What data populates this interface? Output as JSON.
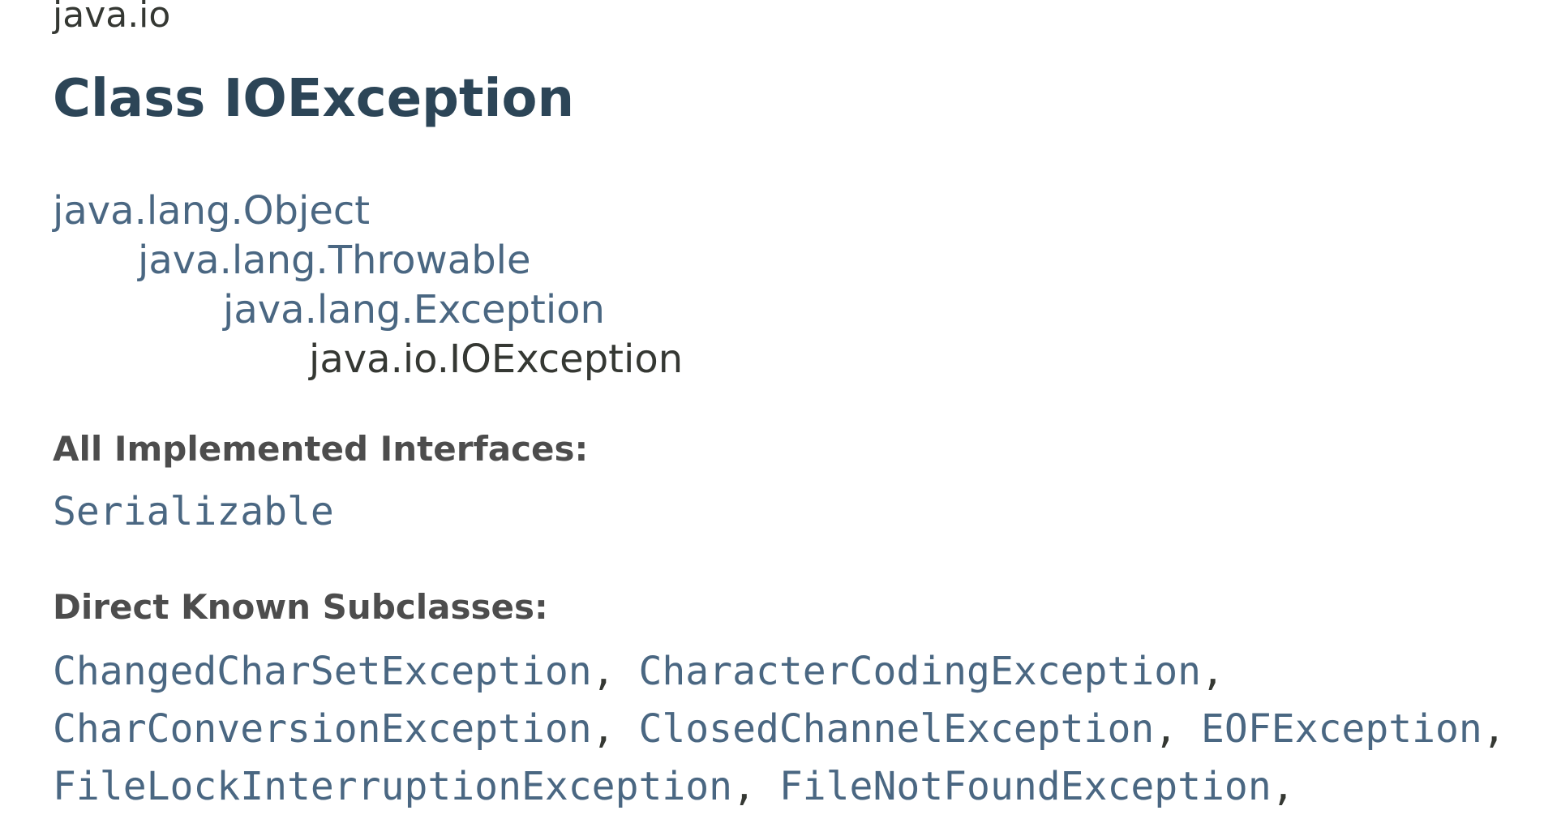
{
  "package": {
    "name": "java.io"
  },
  "title": "Class IOException",
  "hierarchy": [
    {
      "label": "java.lang.Object",
      "link": true
    },
    {
      "label": "java.lang.Throwable",
      "link": true
    },
    {
      "label": "java.lang.Exception",
      "link": true
    },
    {
      "label": "java.io.IOException",
      "link": false
    }
  ],
  "interfaces": {
    "heading": "All Implemented Interfaces:",
    "items": [
      "Serializable"
    ]
  },
  "subclasses": {
    "heading": "Direct Known Subclasses:",
    "items": [
      "ChangedCharSetException",
      "CharacterCodingException",
      "CharConversionException",
      "ClosedChannelException",
      "EOFException",
      "FileLockInterruptionException",
      "FileNotFoundException"
    ],
    "separator": ", "
  },
  "colors": {
    "link": "#4a6782",
    "title": "#2c4557",
    "text": "#353833",
    "heading": "#4d4d4d"
  }
}
